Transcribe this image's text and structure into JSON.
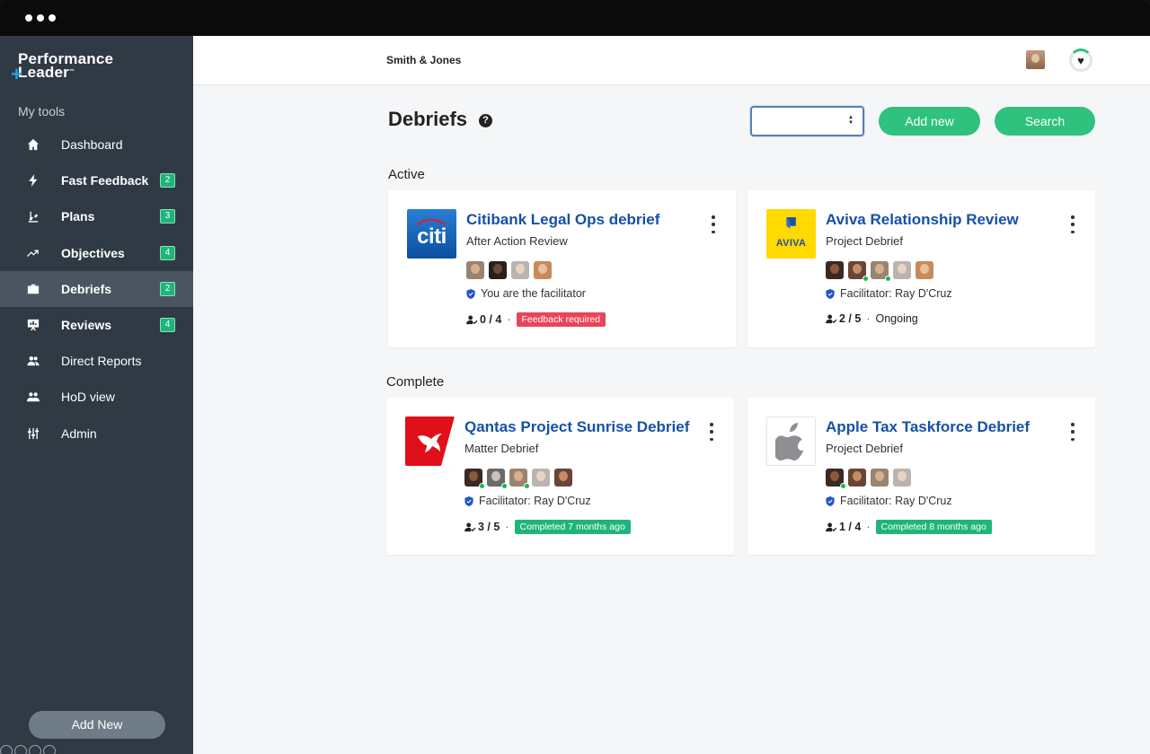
{
  "brand": {
    "line1": "Performance",
    "line2": "Leader",
    "tm": "™"
  },
  "sidebar": {
    "section_label": "My tools",
    "items": [
      {
        "label": "Dashboard",
        "icon": "home-icon",
        "badge": "",
        "bold": false,
        "active": false
      },
      {
        "label": "Fast Feedback",
        "icon": "bolt-icon",
        "badge": "2",
        "bold": true,
        "active": false
      },
      {
        "label": "Plans",
        "icon": "plans-icon",
        "badge": "3",
        "bold": true,
        "active": false
      },
      {
        "label": "Objectives",
        "icon": "trend-icon",
        "badge": "4",
        "bold": true,
        "active": false
      },
      {
        "label": "Debriefs",
        "icon": "briefcase-icon",
        "badge": "2",
        "bold": true,
        "active": true
      },
      {
        "label": "Reviews",
        "icon": "presentation-icon",
        "badge": "4",
        "bold": true,
        "active": false
      },
      {
        "label": "Direct Reports",
        "icon": "people-icon",
        "badge": "",
        "bold": false,
        "active": false
      },
      {
        "label": "HoD view",
        "icon": "group-icon",
        "badge": "",
        "bold": false,
        "active": false
      },
      {
        "label": "Admin",
        "icon": "sliders-icon",
        "badge": "",
        "bold": false,
        "active": false
      }
    ],
    "add_new_label": "Add New"
  },
  "header": {
    "org_name": "Smith & Jones",
    "heart": "♥"
  },
  "page": {
    "title": "Debriefs",
    "help": "?",
    "add_new_label": "Add new",
    "search_label": "Search",
    "caret_up": "▲",
    "caret_down": "▼"
  },
  "groups": {
    "active_label": "Active",
    "complete_label": "Complete"
  },
  "cards": [
    {
      "title": "Citibank Legal Ops debrief",
      "subtitle": "After Action Review",
      "logo": "citi-logo",
      "logo_text": "citi",
      "facilitator": "You are the facilitator",
      "count": "0 / 4",
      "status": "Feedback required",
      "status_type": "red",
      "avatars": [
        {
          "face": "#d7b08e",
          "bg": "#9a8470",
          "online": false
        },
        {
          "face": "#6b4a3a",
          "bg": "#2b1f1a",
          "online": false
        },
        {
          "face": "#e9d4c4",
          "bg": "#b9b4ae",
          "online": false
        },
        {
          "face": "#e8c09e",
          "bg": "#c98a5a",
          "online": false
        }
      ]
    },
    {
      "title": "Aviva Relationship Review",
      "subtitle": "Project Debrief",
      "logo": "aviva-logo",
      "logo_text": "AVIVA",
      "facilitator": "Facilitator: Ray D'Cruz",
      "count": "2 / 5",
      "status": "Ongoing",
      "status_type": "plain",
      "avatars": [
        {
          "face": "#8b5a3c",
          "bg": "#3a2a22",
          "online": false
        },
        {
          "face": "#c58c6a",
          "bg": "#6a4535",
          "online": true
        },
        {
          "face": "#d7b08e",
          "bg": "#9a8470",
          "online": true
        },
        {
          "face": "#e9d4c4",
          "bg": "#b9b4ae",
          "online": false
        },
        {
          "face": "#e8c09e",
          "bg": "#c98a5a",
          "online": false
        }
      ]
    },
    {
      "title": "Qantas Project Sunrise Debrief",
      "subtitle": "Matter Debrief",
      "logo": "qantas-logo",
      "logo_text": "",
      "facilitator": "Facilitator: Ray D'Cruz",
      "count": "3 / 5",
      "status": "Completed 7 months ago",
      "status_type": "green",
      "avatars": [
        {
          "face": "#8b5a3c",
          "bg": "#3a2a22",
          "online": true
        },
        {
          "face": "#c9c3bd",
          "bg": "#6c6a68",
          "online": true
        },
        {
          "face": "#d7b08e",
          "bg": "#9a8470",
          "online": true
        },
        {
          "face": "#e9d4c4",
          "bg": "#b9b4ae",
          "online": false
        },
        {
          "face": "#c58c6a",
          "bg": "#6a4535",
          "online": false
        }
      ]
    },
    {
      "title": "Apple Tax Taskforce Debrief",
      "subtitle": "Project Debrief",
      "logo": "apple-logo",
      "logo_text": "",
      "facilitator": "Facilitator: Ray D'Cruz",
      "count": "1 / 4",
      "status": "Completed 8 months ago",
      "status_type": "green",
      "avatars": [
        {
          "face": "#8b5a3c",
          "bg": "#3a2a22",
          "online": true
        },
        {
          "face": "#c58c6a",
          "bg": "#6a4535",
          "online": false
        },
        {
          "face": "#d7b08e",
          "bg": "#9a8470",
          "online": false
        },
        {
          "face": "#e9d4c4",
          "bg": "#b9b4ae",
          "online": false
        }
      ]
    }
  ],
  "colors": {
    "sidebar_bg": "#2f3a45",
    "accent_green": "#2ec27e",
    "link_blue": "#1650a8",
    "tag_red": "#e8455a"
  }
}
